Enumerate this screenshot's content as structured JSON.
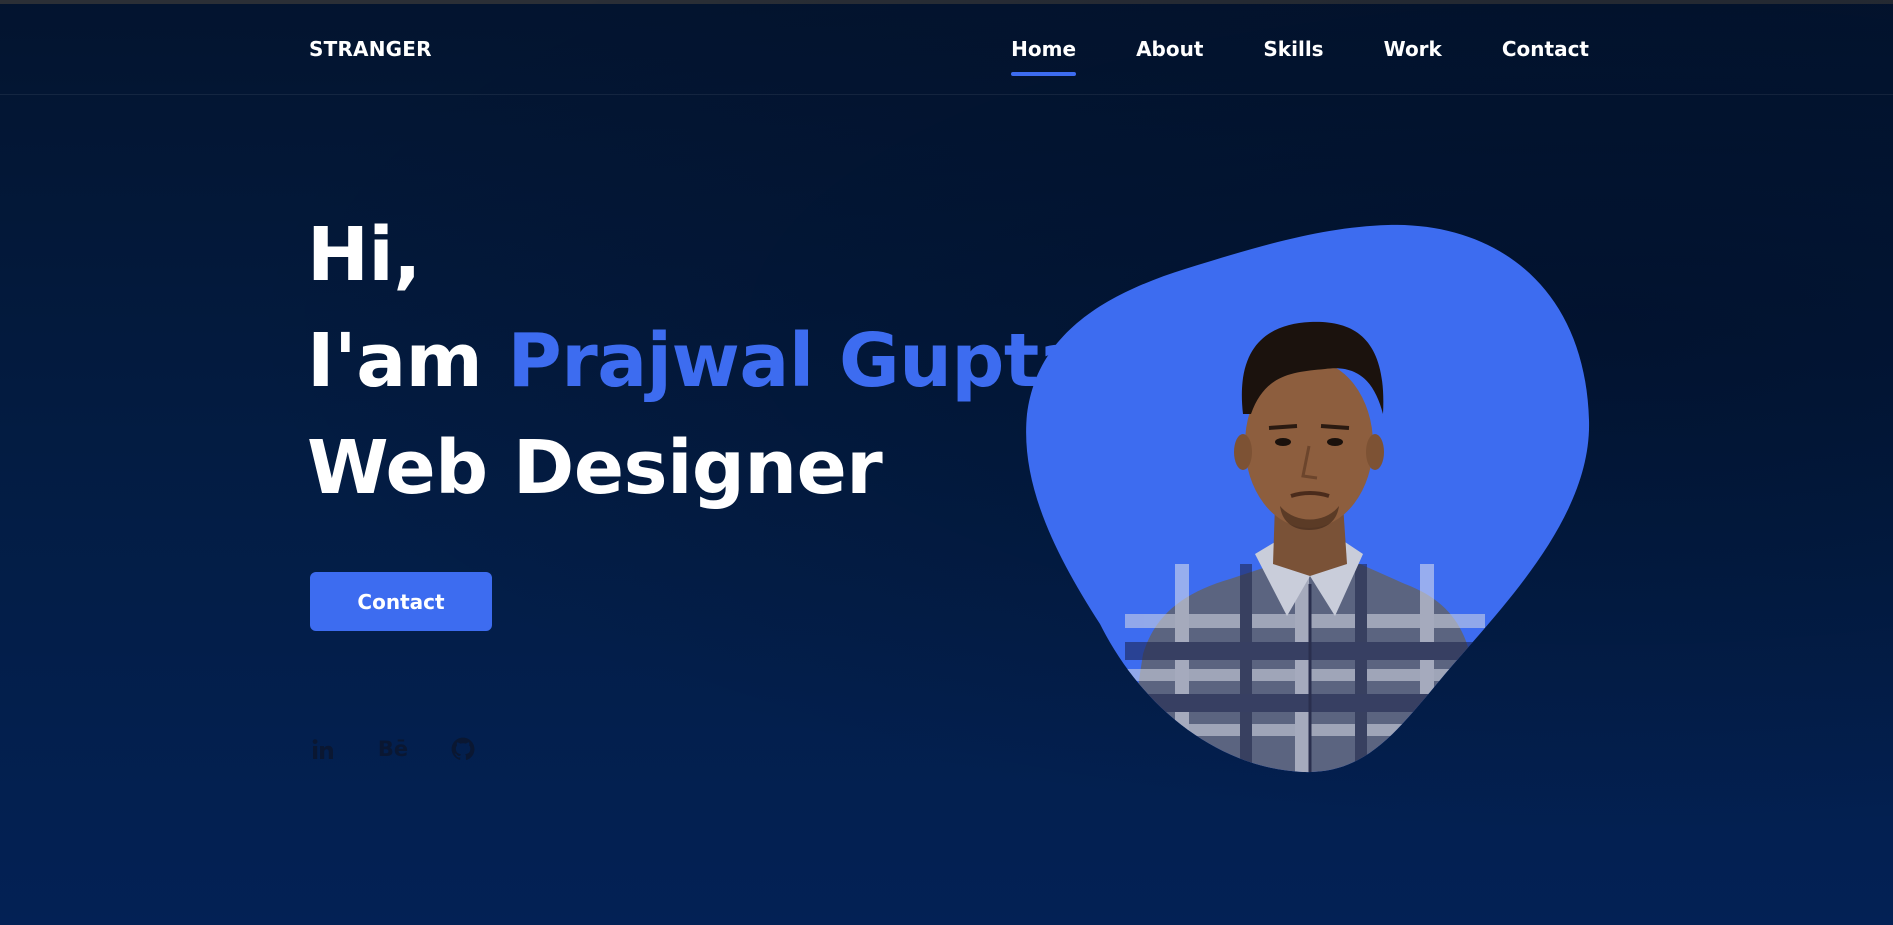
{
  "header": {
    "logo": "STRANGER",
    "nav": [
      {
        "label": "Home",
        "active": true
      },
      {
        "label": "About",
        "active": false
      },
      {
        "label": "Skills",
        "active": false
      },
      {
        "label": "Work",
        "active": false
      },
      {
        "label": "Contact",
        "active": false
      }
    ]
  },
  "hero": {
    "greeting": "Hi,",
    "intro_prefix": "I'am",
    "name": "Prajwal Gupta",
    "role": "Web Designer",
    "cta_label": "Contact"
  },
  "socials": {
    "behance_text": "Bē",
    "icons": [
      "linkedin-icon",
      "behance-icon",
      "github-icon"
    ]
  },
  "colors": {
    "background": "#031c43",
    "accent": "#3d6cf0",
    "text": "#ffffff",
    "social_icons": "#0a1732"
  }
}
